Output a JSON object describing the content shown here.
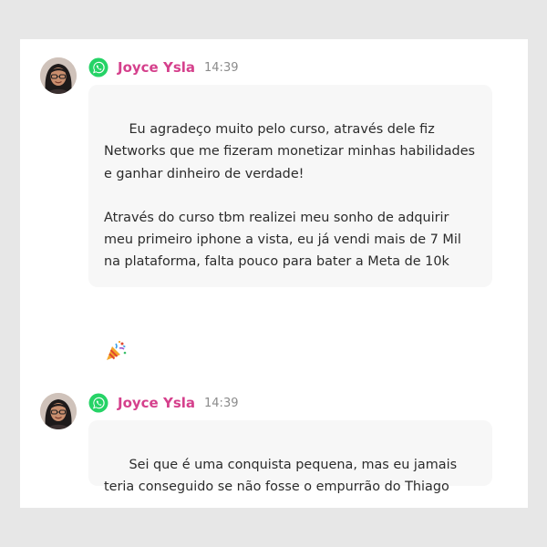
{
  "messages": [
    {
      "sender": "Joyce Ysla",
      "time": "14:39",
      "text": "Eu agradeço muito pelo curso, através dele fiz Networks que me fizeram monetizar minhas habilidades e ganhar dinheiro de verdade!\n\nAtravés do curso tbm realizei meu sonho de adquirir meu primeiro iphone a vista, eu já vendi mais de 7 Mil na plataforma, falta pouco para bater a Meta de 10k",
      "emoji": "🎉",
      "emoji_icon": "party-popper-icon"
    },
    {
      "sender": "Joyce Ysla",
      "time": "14:39",
      "text": "Sei que é uma conquista pequena, mas eu jamais teria conseguido se não fosse o empurrão do Thiago"
    }
  ],
  "icons": {
    "source": "whatsapp-icon",
    "avatar": "avatar"
  },
  "colors": {
    "sender_name": "#d5408c",
    "whatsapp": "#25d366",
    "bubble": "#f7f7f7",
    "background": "#e7e7e7"
  }
}
